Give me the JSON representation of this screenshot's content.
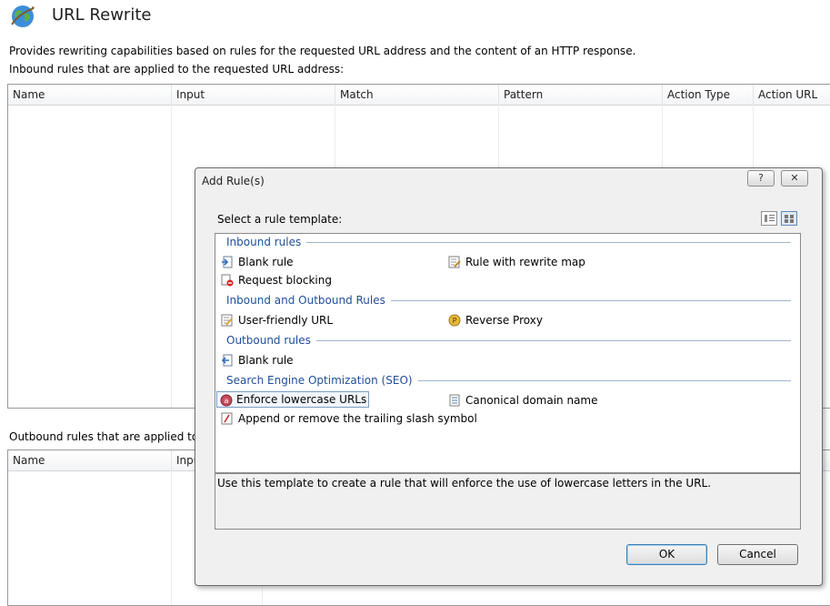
{
  "header": {
    "title": "URL Rewrite",
    "description": "Provides rewriting capabilities based on rules for the requested URL address and the content of an HTTP response.",
    "inbound_label": "Inbound rules that are applied to the requested URL address:",
    "outbound_label": "Outbound rules that are applied to the"
  },
  "inbound_grid": {
    "columns": [
      "Name",
      "Input",
      "Match",
      "Pattern",
      "Action Type",
      "Action URL"
    ]
  },
  "outbound_grid": {
    "columns": [
      "Name",
      "Input"
    ]
  },
  "dialog": {
    "title": "Add Rule(s)",
    "help_label": "?",
    "close_label": "✕",
    "select_label": "Select a rule template:",
    "groups": [
      {
        "label": "Inbound rules",
        "items": [
          {
            "label": "Blank rule",
            "icon": "blank-rule-icon"
          },
          {
            "label": "Rule with rewrite map",
            "icon": "rewrite-map-icon"
          },
          {
            "label": "Request blocking",
            "icon": "request-blocking-icon"
          }
        ]
      },
      {
        "label": "Inbound and Outbound Rules",
        "items": [
          {
            "label": "User-friendly URL",
            "icon": "user-friendly-url-icon"
          },
          {
            "label": "Reverse Proxy",
            "icon": "reverse-proxy-icon"
          }
        ]
      },
      {
        "label": "Outbound rules",
        "items": [
          {
            "label": "Blank rule",
            "icon": "outbound-blank-rule-icon"
          }
        ]
      },
      {
        "label": "Search Engine Optimization (SEO)",
        "items": [
          {
            "label": "Enforce lowercase URLs",
            "icon": "lowercase-urls-icon",
            "selected": true
          },
          {
            "label": "Canonical domain name",
            "icon": "canonical-domain-icon"
          },
          {
            "label": "Append or remove the trailing slash symbol",
            "icon": "trailing-slash-icon"
          }
        ]
      }
    ],
    "description": "Use this template to create a rule that will enforce the use of lowercase letters in the URL.",
    "ok_label": "OK",
    "cancel_label": "Cancel"
  },
  "colors": {
    "group_text": "#1f4e9a",
    "dialog_bg": "#f0f0f0"
  }
}
